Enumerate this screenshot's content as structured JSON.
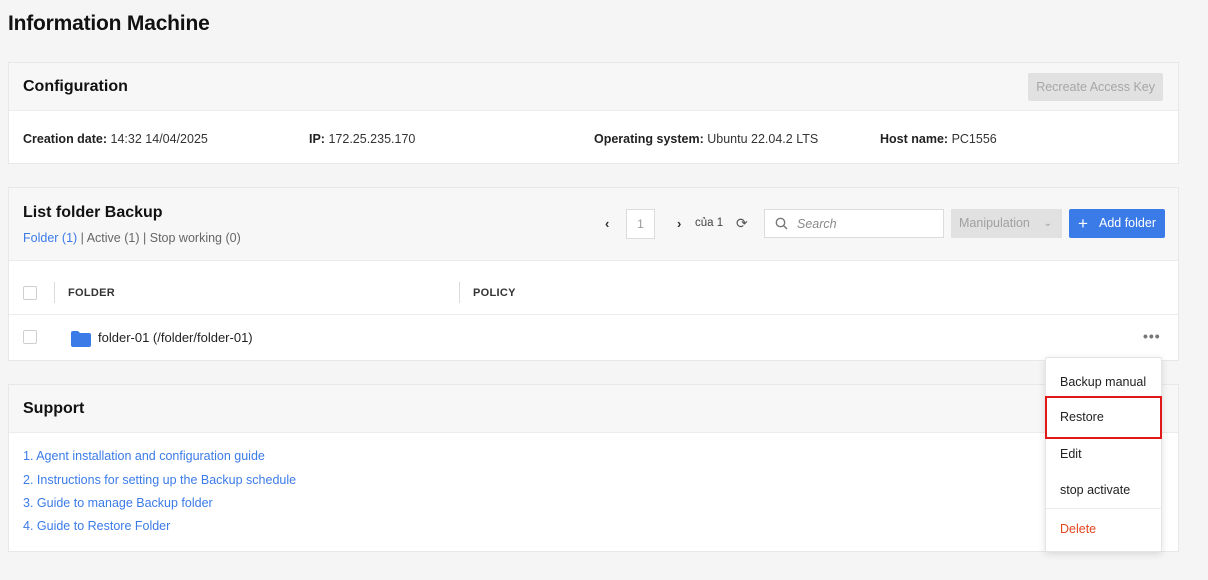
{
  "page": {
    "title": "Information Machine"
  },
  "config": {
    "title": "Configuration",
    "recreate_label": "Recreate Access Key",
    "creation_date_label": "Creation date:",
    "creation_date_value": "14:32 14/04/2025",
    "ip_label": "IP:",
    "ip_value": "172.25.235.170",
    "os_label": "Operating system:",
    "os_value": "Ubuntu 22.04.2 LTS",
    "host_label": "Host name:",
    "host_value": "PC1556"
  },
  "folders": {
    "title": "List folder Backup",
    "filter_folder": "Folder (1)",
    "filter_active": "Active (1)",
    "filter_stop": "Stop working (0)",
    "filter_sep": "|",
    "pager": {
      "prev": "‹",
      "page": "1",
      "next": "›",
      "of_text": "của 1",
      "refresh": "⟳"
    },
    "search_placeholder": "Search",
    "manipulation_label": "Manipulation",
    "add_label": "Add folder",
    "columns": {
      "folder": "FOLDER",
      "policy": "POLICY"
    },
    "rows": [
      {
        "name": "folder-01 (/folder/folder-01)",
        "policy": ""
      }
    ],
    "more": "•••"
  },
  "support": {
    "title": "Support",
    "links": [
      "1. Agent installation and configuration guide",
      "2. Instructions for setting up the Backup schedule",
      "3. Guide to manage Backup folder",
      "4. Guide to Restore Folder"
    ]
  },
  "menu": {
    "items": [
      "Backup manual",
      "Restore",
      "Edit",
      "stop activate",
      "Delete"
    ],
    "highlighted": "Restore",
    "danger_color": "#e2481f"
  },
  "colors": {
    "accent": "#3b7be8",
    "highlight_border": "#e01818"
  }
}
